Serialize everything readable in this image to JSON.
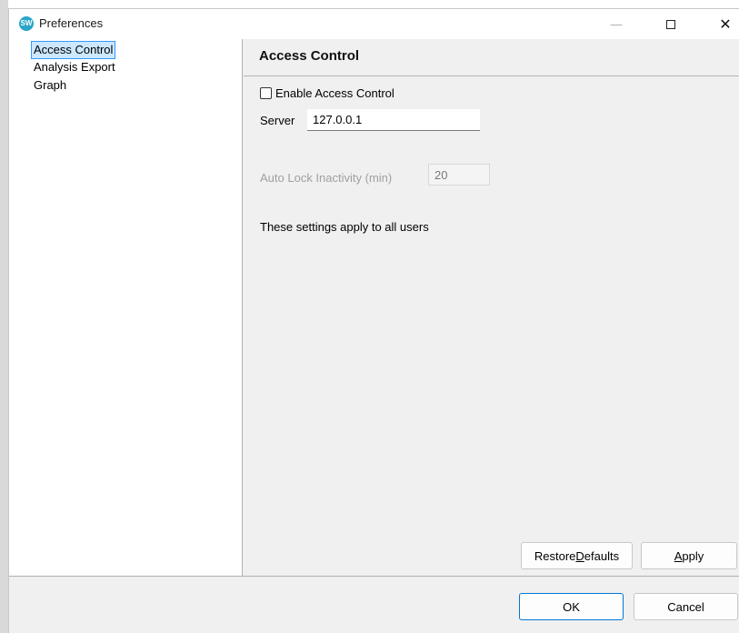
{
  "window": {
    "title": "Preferences",
    "app_icon_text": "SW",
    "minimize_glyph": "—",
    "close_glyph": "✕"
  },
  "tree": {
    "items": [
      {
        "label": "Access Control",
        "selected": true
      },
      {
        "label": "Analysis Export",
        "selected": false
      },
      {
        "label": "Graph",
        "selected": false
      }
    ]
  },
  "panel": {
    "title": "Access Control",
    "enable_label": "Enable Access Control",
    "enable_checked": false,
    "server_label": "Server",
    "server_value": "127.0.0.1",
    "auto_lock_label": "Auto Lock Inactivity (min)",
    "auto_lock_value": "20",
    "note": "These settings apply to all users"
  },
  "buttons": {
    "restore_pre": "Restore ",
    "restore_mnemonic": "D",
    "restore_post": "efaults",
    "apply_mnemonic": "A",
    "apply_post": "pply",
    "ok": "OK",
    "cancel": "Cancel"
  },
  "icons": {
    "app": "sw-app-icon",
    "minimize": "minimize-icon",
    "maximize": "maximize-icon",
    "close": "close-icon"
  }
}
